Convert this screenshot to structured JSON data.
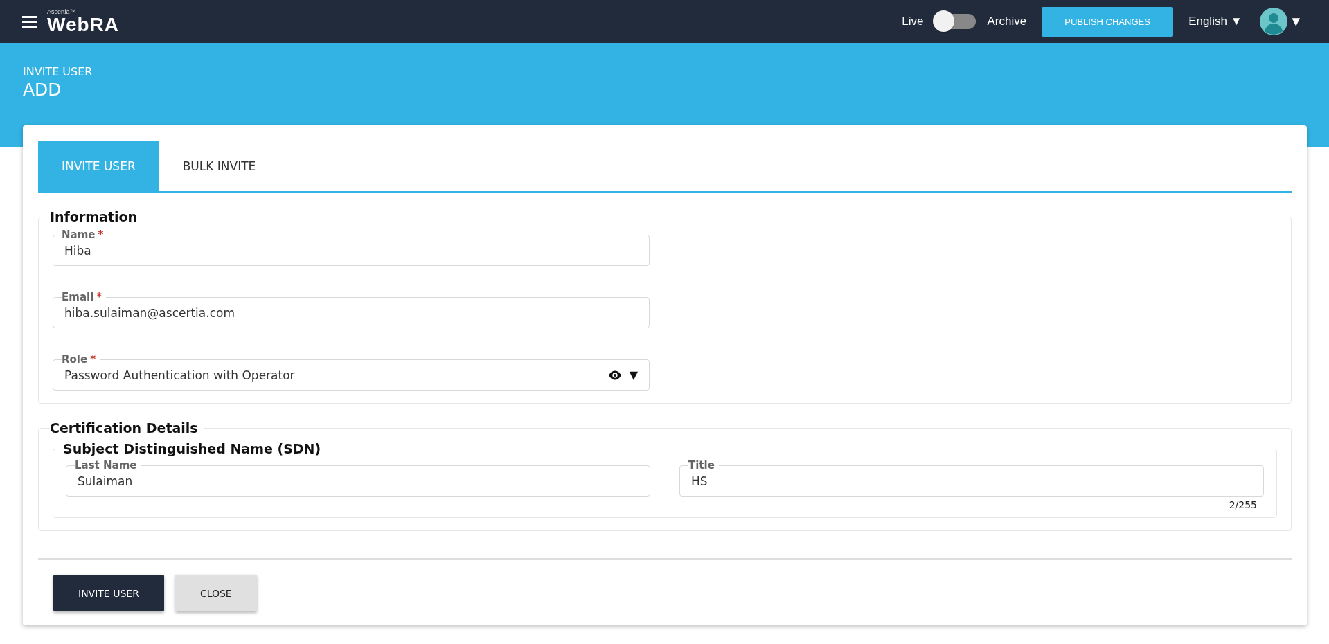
{
  "header": {
    "brand_small": "Ascertia™",
    "brand": "WebRA",
    "mode_toggle": {
      "left_label": "Live",
      "right_label": "Archive",
      "on": false
    },
    "publish_button": "PUBLISH CHANGES",
    "language": {
      "label": "English",
      "caret": "▼"
    },
    "user_caret": "▼"
  },
  "page": {
    "breadcrumb": "INVITE USER",
    "title": "ADD"
  },
  "tabs": [
    {
      "label": "INVITE USER",
      "selected": true
    },
    {
      "label": "BULK INVITE",
      "selected": false
    }
  ],
  "information": {
    "legend": "Information",
    "fields": [
      {
        "kind": "text",
        "label": "Name",
        "required_mark": "*",
        "value": "Hiba"
      },
      {
        "kind": "text",
        "label": "Email",
        "required_mark": "*",
        "value": "hiba.sulaiman@ascertia.com"
      },
      {
        "kind": "select",
        "label": "Role",
        "required_mark": "*",
        "value": "Password Authentication with Operator",
        "caret": "▼"
      }
    ]
  },
  "certification": {
    "legend": "Certification Details",
    "sdn": {
      "legend": "Subject Distinguished Name (SDN)",
      "fields": [
        {
          "kind": "text",
          "label": "Last Name",
          "value": "Sulaiman"
        },
        {
          "kind": "text",
          "label": "Title",
          "value": "HS",
          "counter": "2/255"
        }
      ]
    }
  },
  "buttons": [
    {
      "kind": "primary",
      "label": "INVITE USER"
    },
    {
      "kind": "secondary",
      "label": "CLOSE"
    }
  ]
}
